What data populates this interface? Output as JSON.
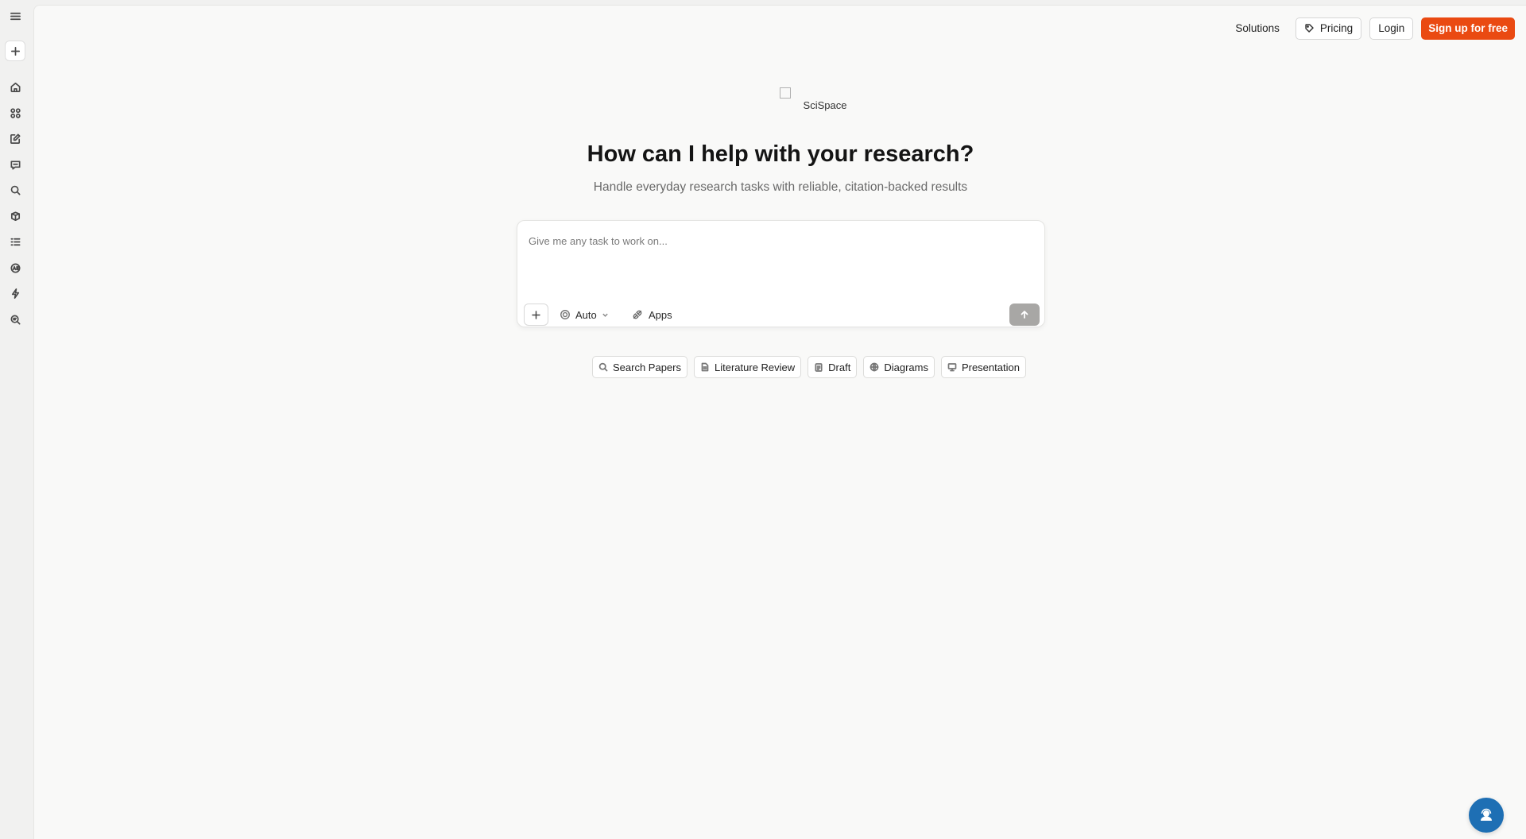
{
  "app": {
    "brand_alt": "SciSpace"
  },
  "topnav": {
    "solutions": "Solutions",
    "pricing": "Pricing",
    "login": "Login",
    "signup": "Sign up for free",
    "signup_color": "#ea4a12"
  },
  "sidebar": {
    "items": [
      {
        "icon": "menu-icon"
      },
      {
        "icon": "plus-icon"
      },
      {
        "icon": "home-icon"
      },
      {
        "icon": "apps-icon"
      },
      {
        "icon": "edit-icon"
      },
      {
        "icon": "chat-icon"
      },
      {
        "icon": "search-icon"
      },
      {
        "icon": "library-icon"
      },
      {
        "icon": "list-icon"
      },
      {
        "icon": "ai-detector-icon"
      },
      {
        "icon": "lightning-icon"
      },
      {
        "icon": "search-document-icon"
      }
    ]
  },
  "hero": {
    "title": "How can I help with your research?",
    "subtitle": "Handle everyday research tasks with reliable, citation-backed results"
  },
  "composer": {
    "placeholder": "Give me any task to work on...",
    "mode": "Auto",
    "apps": "Apps"
  },
  "chips": [
    {
      "label": "Search Papers",
      "icon": "search-icon"
    },
    {
      "label": "Literature Review",
      "icon": "document-icon"
    },
    {
      "label": "Draft",
      "icon": "clipboard-icon"
    },
    {
      "label": "Diagrams",
      "icon": "globe-icon"
    },
    {
      "label": "Presentation",
      "icon": "monitor-icon"
    }
  ],
  "help": {
    "icon": "support-agent-icon",
    "color": "#1e6fb4"
  }
}
